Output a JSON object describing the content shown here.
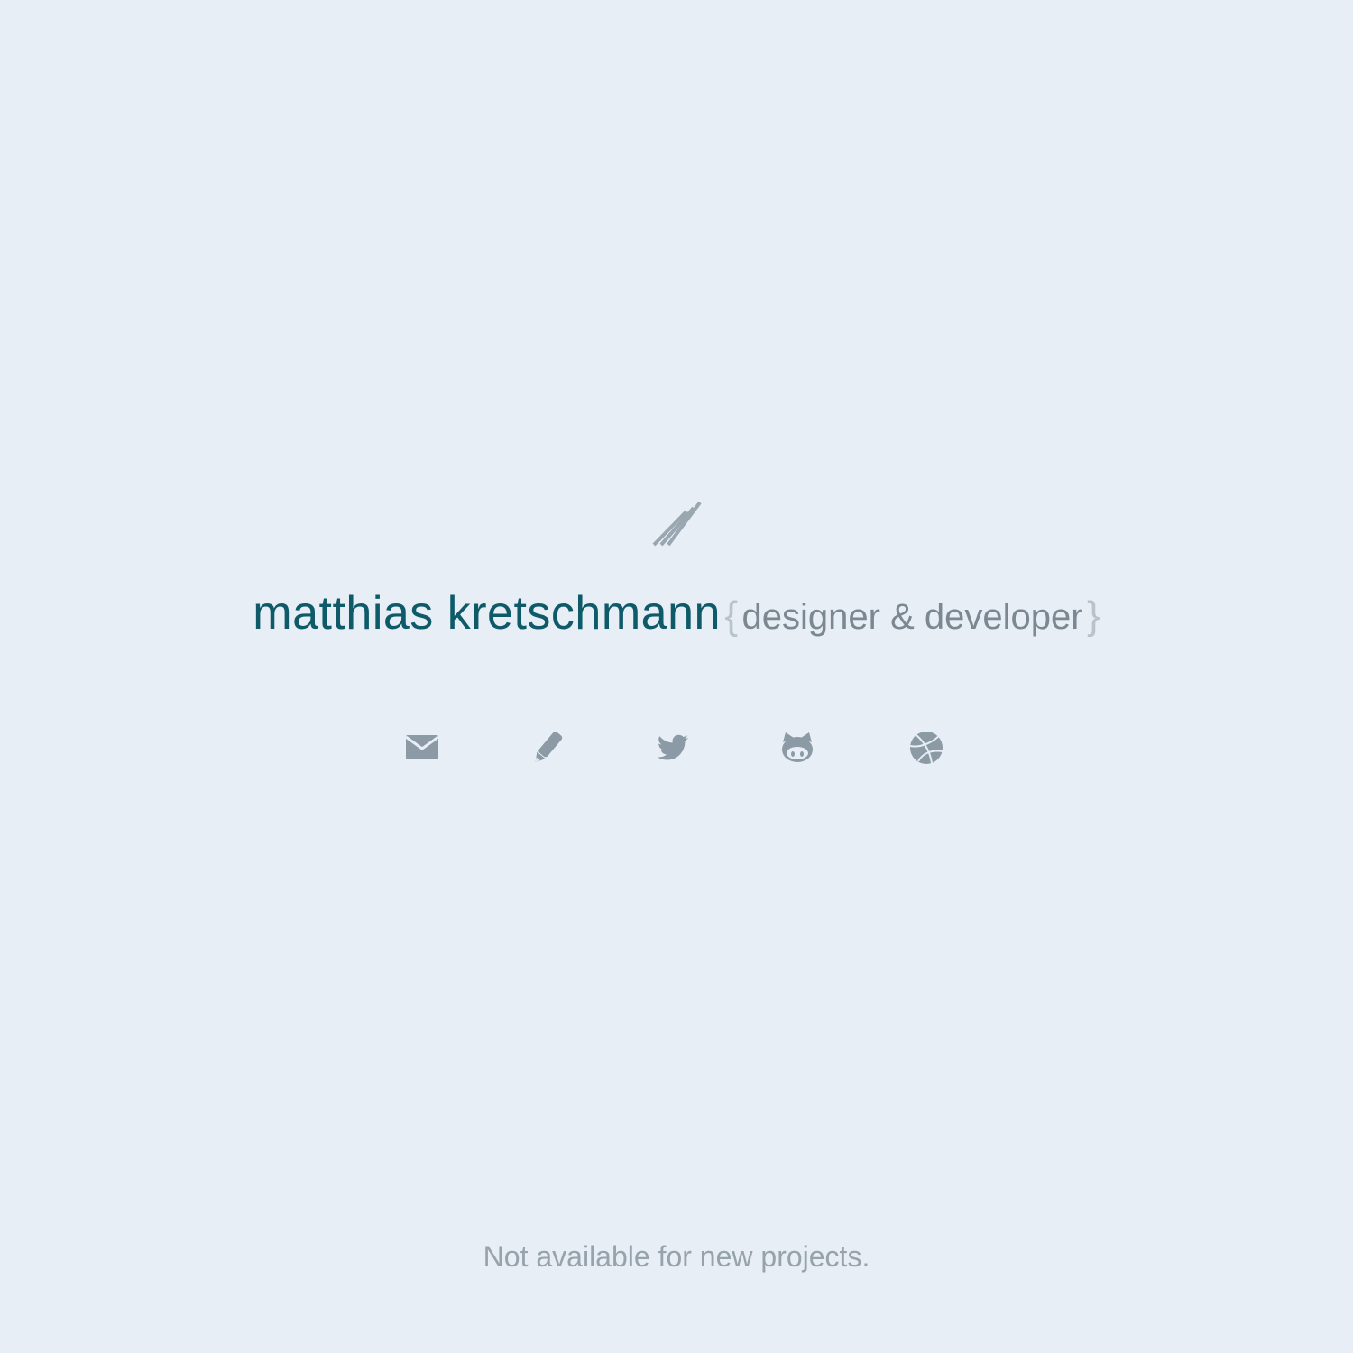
{
  "header": {
    "name": "matthias kretschmann",
    "brace_open": "{",
    "role": "designer & developer",
    "brace_close": "}"
  },
  "logo": {
    "icon": "slashes-logo-icon"
  },
  "social": [
    {
      "icon": "mail-icon"
    },
    {
      "icon": "pencil-icon"
    },
    {
      "icon": "twitter-icon"
    },
    {
      "icon": "github-icon"
    },
    {
      "icon": "dribbble-icon"
    }
  ],
  "footer": {
    "availability": "Not available for new projects."
  },
  "colors": {
    "background": "#e7eef5",
    "name": "#0f5a69",
    "role": "#7b8892",
    "icons": "#8c9aa5",
    "footer": "#97a3ac"
  }
}
